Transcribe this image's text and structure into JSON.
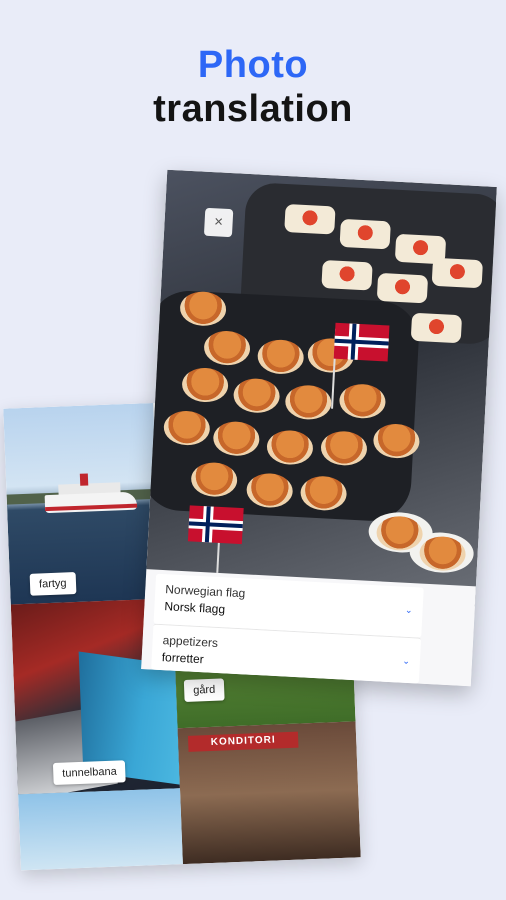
{
  "header": {
    "title_line1": "Photo",
    "title_line2": "translation"
  },
  "collage": {
    "labels": [
      "fartyg",
      "tunnelbana",
      "gård"
    ],
    "cafe_sign": "KONDITORI"
  },
  "photo_card": {
    "close_label": "×",
    "translations": [
      {
        "source": "Norwegian flag",
        "target": "Norsk flagg"
      },
      {
        "source": "appetizers",
        "target": "forretter"
      }
    ],
    "chevron": "⌄"
  },
  "colors": {
    "accent": "#2d67f6",
    "background": "#e9ecf8"
  }
}
